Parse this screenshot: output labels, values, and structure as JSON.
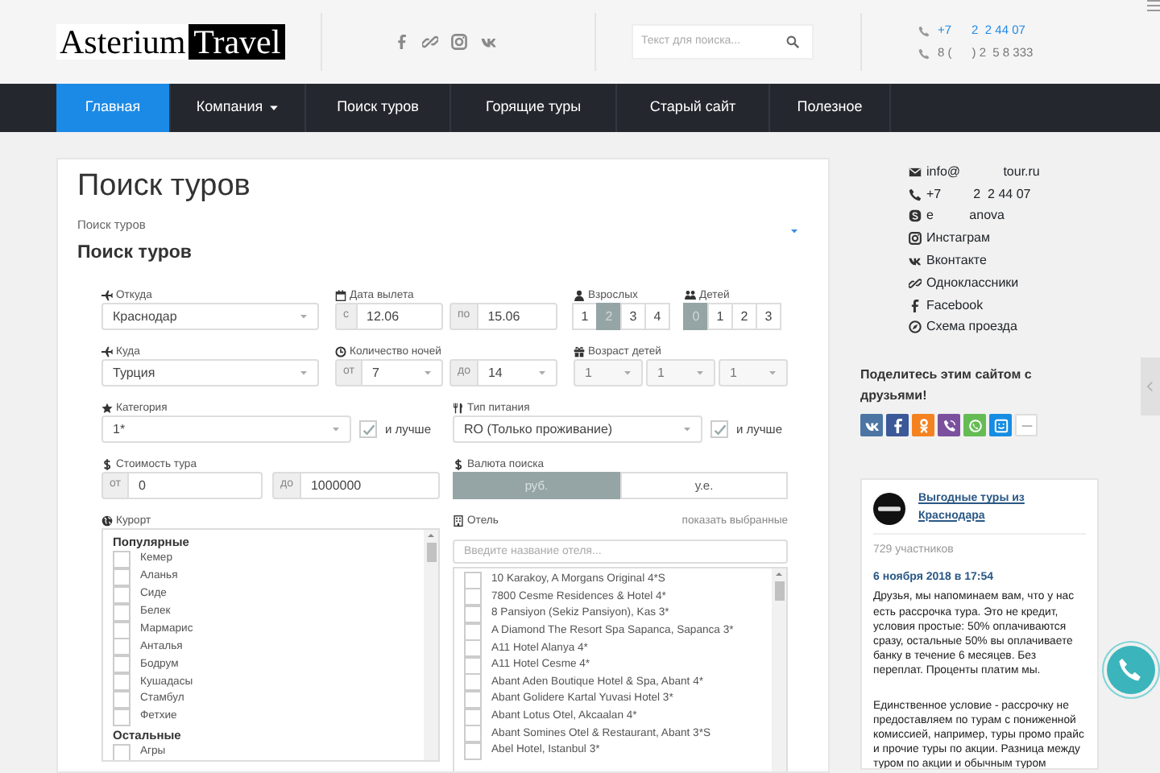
{
  "header": {
    "logo": [
      "Asterium",
      "Travel"
    ],
    "search": {
      "placeholder": "Текст для поиска..."
    },
    "phones": [
      {
        "text": "+7      2  2 44 07",
        "link": true
      },
      {
        "text": "8 (      ) 2  5 8 333",
        "link": false
      }
    ]
  },
  "nav": [
    {
      "label": "Главная",
      "selected": true,
      "dropdown": false
    },
    {
      "label": "Компания",
      "selected": false,
      "dropdown": true
    },
    {
      "label": "Поиск туров",
      "selected": false,
      "dropdown": false
    },
    {
      "label": "Горящие туры",
      "selected": false,
      "dropdown": false
    },
    {
      "label": "Старый сайт",
      "selected": false,
      "dropdown": false
    },
    {
      "label": "Полезное",
      "selected": false,
      "dropdown": false
    }
  ],
  "page": {
    "title": "Поиск туров",
    "breadcrumb": "Поиск туров",
    "subtitle": "Поиск туров"
  },
  "form": {
    "from": {
      "label": "Откуда",
      "value": "Краснодар"
    },
    "dates": {
      "label": "Дата вылета",
      "from_prefix": "с",
      "from": "12.06",
      "to_prefix": "по",
      "to": "15.06"
    },
    "adults": {
      "label": "Взрослых",
      "options": [
        {
          "label": "1",
          "selected": false
        },
        {
          "label": "2",
          "selected": true
        },
        {
          "label": "3",
          "selected": false
        },
        {
          "label": "4",
          "selected": false
        }
      ]
    },
    "children": {
      "label": "Детей",
      "options": [
        {
          "label": "0",
          "selected": true
        },
        {
          "label": "1",
          "selected": false
        },
        {
          "label": "2",
          "selected": false
        },
        {
          "label": "3",
          "selected": false
        }
      ]
    },
    "to": {
      "label": "Куда",
      "value": "Турция"
    },
    "nights": {
      "label": "Количество ночей",
      "from_prefix": "от",
      "from": "7",
      "to_prefix": "до",
      "to": "14"
    },
    "child_ages": {
      "label": "Возраст детей",
      "selects": [
        {
          "value": "1",
          "disabled": true
        },
        {
          "value": "1",
          "disabled": true
        },
        {
          "value": "1",
          "disabled": true
        }
      ]
    },
    "category": {
      "label": "Категория",
      "value": "1*",
      "better": {
        "label": "и лучше",
        "checked": true
      }
    },
    "meal": {
      "label": "Тип питания",
      "value": "RO (Только проживание)",
      "better": {
        "label": "и лучше",
        "checked": true
      }
    },
    "price": {
      "label": "Стоимость тура",
      "from_prefix": "от",
      "from": "0",
      "to_prefix": "до",
      "to": "1000000"
    },
    "currency": {
      "label": "Валюта поиска",
      "options": [
        {
          "label": "руб.",
          "selected": true
        },
        {
          "label": "у.е.",
          "selected": false
        }
      ]
    },
    "resort": {
      "label": "Курорт",
      "groups": [
        {
          "title": "Популярные",
          "items": [
            {
              "label": "Кемер",
              "checked": false
            },
            {
              "label": "Аланья",
              "checked": false
            },
            {
              "label": "Сиде",
              "checked": false
            },
            {
              "label": "Белек",
              "checked": false
            },
            {
              "label": "Мармарис",
              "checked": false
            },
            {
              "label": "Анталья",
              "checked": false
            },
            {
              "label": "Бодрум",
              "checked": false
            },
            {
              "label": "Кушадасы",
              "checked": false
            },
            {
              "label": "Стамбул",
              "checked": false
            },
            {
              "label": "Фетхие",
              "checked": false
            }
          ]
        },
        {
          "title": "Остальные",
          "items": [
            {
              "label": "Агры",
              "checked": false
            }
          ]
        }
      ]
    },
    "hotel": {
      "label": "Отель",
      "show_selected": "показать выбранные",
      "placeholder": "Введите название отеля...",
      "items": [
        {
          "label": "10 Karakoy, A Morgans Original 4*S",
          "checked": false
        },
        {
          "label": "7800 Cesme Residences & Hotel 4*",
          "checked": false
        },
        {
          "label": "8 Pansiyon (Sekiz Pansiyon), Kas 3*",
          "checked": false
        },
        {
          "label": "A Diamond The Resort Spa Sapanca, Sapanca 3*",
          "checked": false
        },
        {
          "label": "A11 Hotel Alanya 4*",
          "checked": false
        },
        {
          "label": "A11 Hotel Cesme 4*",
          "checked": false
        },
        {
          "label": "Abant Aden Boutique Hotel & Spa, Abant 4*",
          "checked": false
        },
        {
          "label": "Abant Golidere Kartal Yuvasi Hotel 3*",
          "checked": false
        },
        {
          "label": "Abant Lotus Otel, Akcaalan 4*",
          "checked": false
        },
        {
          "label": "Abant Somines Otel & Restaurant, Abant 3*S",
          "checked": false
        },
        {
          "label": "Abel Hotel, Istanbul 3*",
          "checked": false
        }
      ]
    }
  },
  "contacts": [
    {
      "kind": "email",
      "text": "info@            tour.ru"
    },
    {
      "kind": "phone",
      "text": "+7         2  2 44 07"
    },
    {
      "kind": "skype",
      "text": "e          anova"
    },
    {
      "kind": "instagram",
      "text": "Инстаграм"
    },
    {
      "kind": "vk",
      "text": "Вконтакте"
    },
    {
      "kind": "ok",
      "text": "Одноклассники"
    },
    {
      "kind": "facebook",
      "text": "Facebook"
    },
    {
      "kind": "map",
      "text": "Схема проезда"
    }
  ],
  "share": {
    "title": "Поделитесь этим сайтом с друзьями!",
    "buttons": [
      {
        "kind": "vk",
        "color": "#4c75a3"
      },
      {
        "kind": "facebook",
        "color": "#3b5998"
      },
      {
        "kind": "ok",
        "color": "#f58220"
      },
      {
        "kind": "viber",
        "color": "#7b519d"
      },
      {
        "kind": "whatsapp",
        "color": "#65bc54"
      },
      {
        "kind": "mail",
        "color": "#168de2"
      },
      {
        "kind": "more",
        "color": "#ffffff"
      }
    ]
  },
  "vk_widget": {
    "title": "Выгодные туры из Краснодара",
    "members": "729 участников",
    "date": "6 ноября 2018 в 17:54",
    "paragraphs": [
      "Друзья, мы напоминаем вам, что у нас есть рассрочка тура. Это не кредит, условия простые: 50% оплачиваются сразу, остальные 50% вы оплачиваете банку в течение 6 месяцев. Без переплат. Проценты платим мы.",
      "Единственное условие - рассрочку не предоставляем по турам с пониженной комиссией, например, туры промо прайс и прочие туры по акции. Разница между туром по акции и обычным туром"
    ]
  }
}
